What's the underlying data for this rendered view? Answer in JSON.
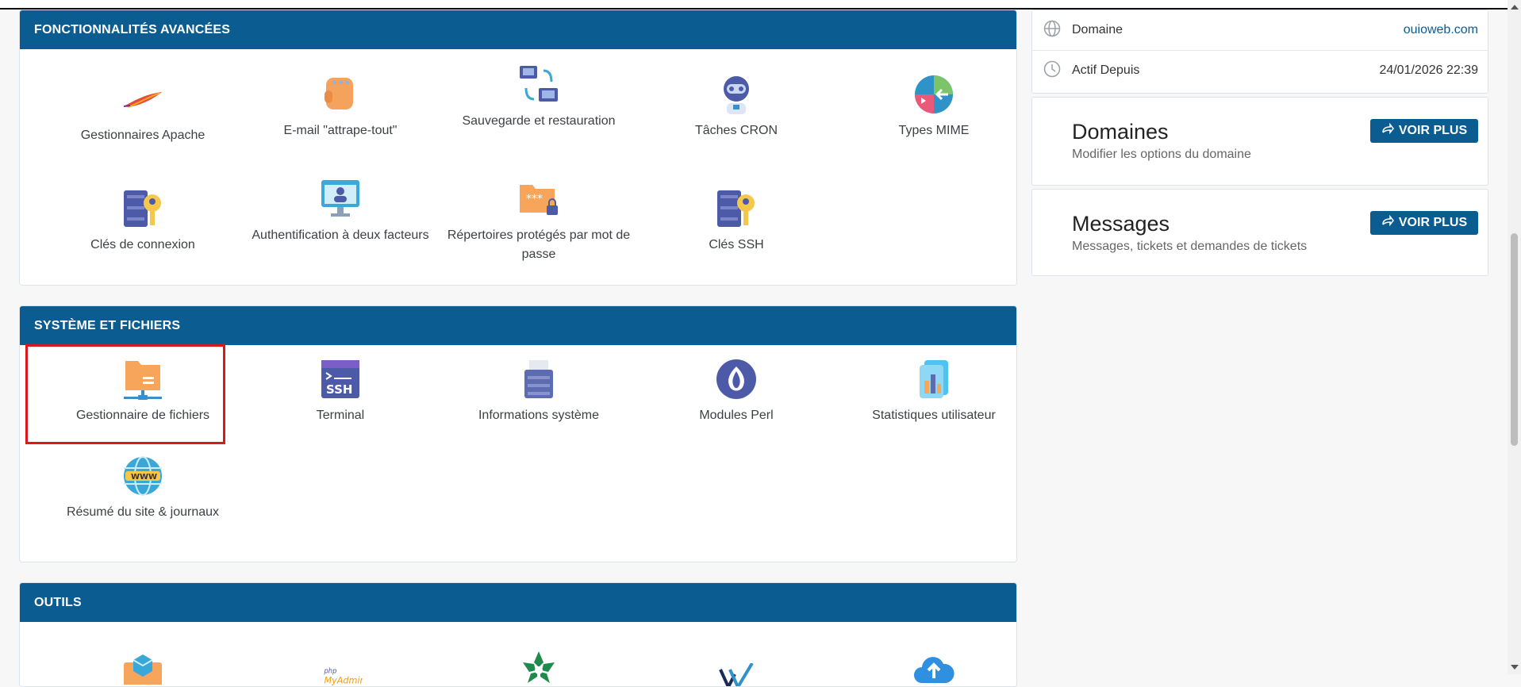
{
  "advanced": {
    "title": "FONCTIONNALITÉS AVANCÉES",
    "items": [
      {
        "label": "Gestionnaires Apache"
      },
      {
        "label": "E-mail \"attrape-tout\""
      },
      {
        "label": "Sauvegarde et restauration"
      },
      {
        "label": "Tâches CRON"
      },
      {
        "label": "Types MIME"
      },
      {
        "label": "Clés de connexion"
      },
      {
        "label": "Authentification à deux facteurs"
      },
      {
        "label": "Répertoires protégés par mot de passe"
      },
      {
        "label": "Clés SSH"
      }
    ]
  },
  "system": {
    "title": "SYSTÈME ET FICHIERS",
    "items": [
      {
        "label": "Gestionnaire de fichiers"
      },
      {
        "label": "Terminal"
      },
      {
        "label": "Informations système"
      },
      {
        "label": "Modules Perl"
      },
      {
        "label": "Statistiques utilisateur"
      },
      {
        "label": "Résumé du site & journaux"
      }
    ]
  },
  "tools": {
    "title": "OUTILS",
    "items": [
      {
        "label": "",
        "icon": "box-icon"
      },
      {
        "label": "",
        "icon": "phpmyadmin-icon",
        "logo_text": "php MyAdmin"
      },
      {
        "label": "",
        "icon": "leaf-star-icon"
      },
      {
        "label": "",
        "icon": "check-logo-icon"
      },
      {
        "label": "",
        "icon": "cloud-upload-icon"
      }
    ]
  },
  "info": {
    "domain_label": "Domaine",
    "domain_value": "ouioweb.com",
    "since_label": "Actif Depuis",
    "since_value": "24/01/2026 22:39"
  },
  "domaines": {
    "title": "Domaines",
    "subtitle": "Modifier les options du domaine",
    "button": "VOIR PLUS"
  },
  "messages": {
    "title": "Messages",
    "subtitle": "Messages, tickets et demandes de tickets",
    "button": "VOIR PLUS"
  },
  "colors": {
    "header": "#0b5c91",
    "highlight": "#d9191c",
    "link": "#0b5c91"
  }
}
